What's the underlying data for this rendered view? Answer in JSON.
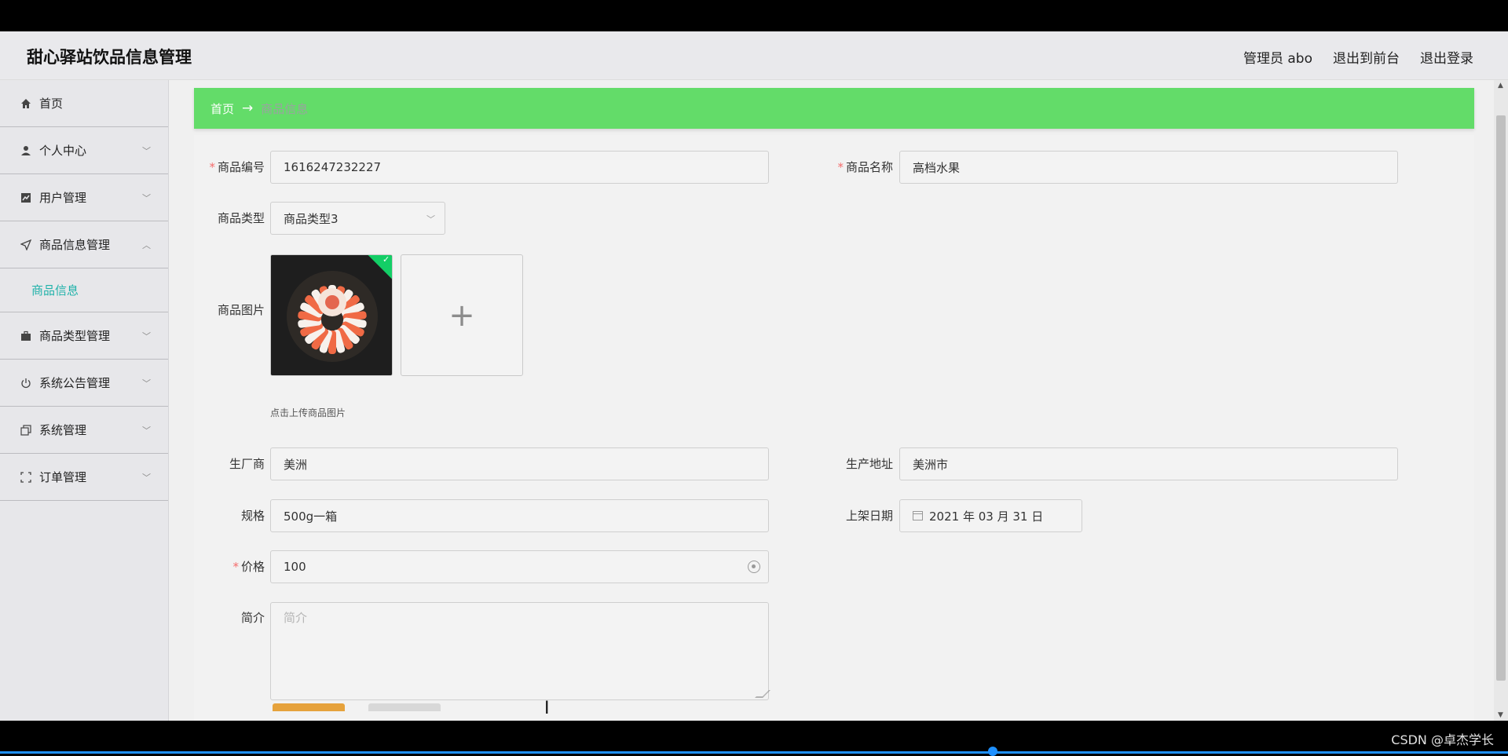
{
  "app": {
    "title": "甜心驿站饮品信息管理"
  },
  "header": {
    "user": "管理员 abo",
    "to_front": "退出到前台",
    "logout": "退出登录"
  },
  "sidebar": {
    "items": [
      {
        "label": "首页",
        "icon": "home-icon"
      },
      {
        "label": "个人中心",
        "icon": "user-icon"
      },
      {
        "label": "用户管理",
        "icon": "chart-icon"
      },
      {
        "label": "商品信息管理",
        "icon": "send-icon",
        "expanded": true
      },
      {
        "label": "商品类型管理",
        "icon": "briefcase-icon"
      },
      {
        "label": "系统公告管理",
        "icon": "power-icon"
      },
      {
        "label": "系统管理",
        "icon": "copy-icon"
      },
      {
        "label": "订单管理",
        "icon": "scan-icon"
      }
    ],
    "submenu_active": "商品信息"
  },
  "breadcrumb": {
    "home": "首页",
    "arrow": "→",
    "current": "商品信息"
  },
  "form": {
    "product_no_label": "商品编号",
    "product_no": "1616247232227",
    "product_name_label": "商品名称",
    "product_name": "高档水果",
    "product_type_label": "商品类型",
    "product_type": "商品类型3",
    "product_image_label": "商品图片",
    "upload_plus": "+",
    "upload_hint": "点击上传商品图片",
    "manufacturer_label": "生厂商",
    "manufacturer": "美洲",
    "address_label": "生产地址",
    "address": "美洲市",
    "spec_label": "规格",
    "spec": "500g一箱",
    "date_label": "上架日期",
    "date": "2021 年 03 月 31 日",
    "price_label": "价格",
    "price": "100",
    "intro_label": "简介",
    "intro_placeholder": "简介"
  },
  "colors": {
    "breadcrumb_bg": "#63dc69",
    "submenu_active": "#20b2aa",
    "required": "#f56c6c"
  },
  "watermark": "CSDN @卓杰学长"
}
